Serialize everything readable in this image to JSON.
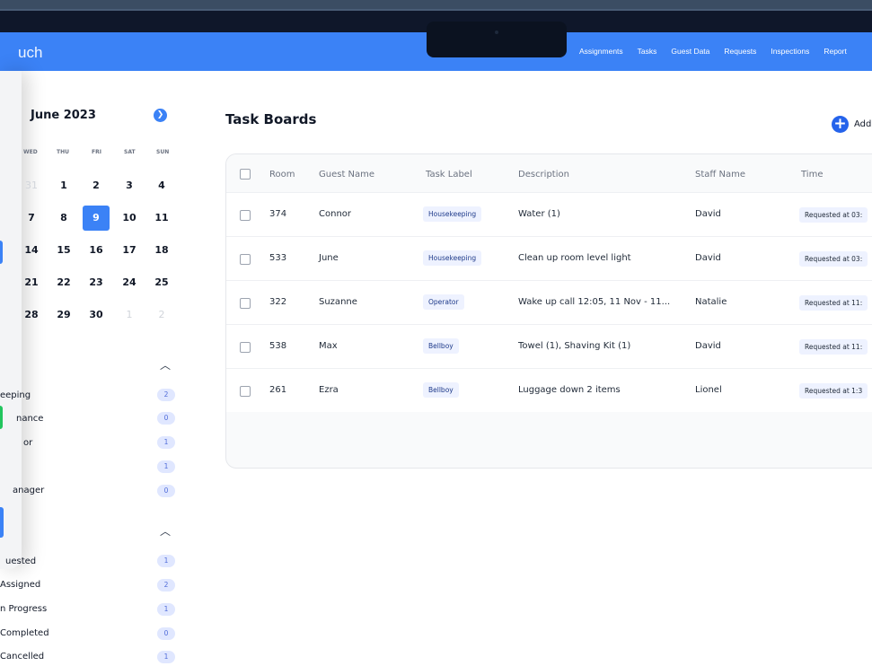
{
  "header": {
    "brand": "uch",
    "nav": [
      "Assignments",
      "Tasks",
      "Guest Data",
      "Requests",
      "Inspections",
      "Report"
    ]
  },
  "calendar": {
    "title": "June 2023",
    "weekdays": [
      "WED",
      "THU",
      "FRI",
      "SAT",
      "SUN"
    ],
    "weeks": [
      [
        "31",
        "1",
        "2",
        "3",
        "4"
      ],
      [
        "7",
        "8",
        "9",
        "10",
        "11"
      ],
      [
        "14",
        "15",
        "16",
        "17",
        "18"
      ],
      [
        "21",
        "22",
        "23",
        "24",
        "25"
      ],
      [
        "28",
        "29",
        "30",
        "1",
        "2"
      ]
    ],
    "selected": "9"
  },
  "categories": [
    {
      "label": "eeping",
      "count": "2"
    },
    {
      "label": "nance",
      "count": "0"
    },
    {
      "label": "or",
      "count": "1"
    },
    {
      "label": "",
      "count": "1"
    },
    {
      "label": "anager",
      "count": "0"
    }
  ],
  "statuses": [
    {
      "label": "uested",
      "count": "1"
    },
    {
      "label": "Assigned",
      "count": "2"
    },
    {
      "label": "n Progress",
      "count": "1"
    },
    {
      "label": "Completed",
      "count": "0"
    },
    {
      "label": "Cancelled",
      "count": "1"
    }
  ],
  "main": {
    "title": "Task Boards",
    "add_label": "Add",
    "columns": [
      "Room",
      "Guest Name",
      "Task Label",
      "Description",
      "Staff Name",
      "Time"
    ],
    "rows": [
      {
        "room": "374",
        "guest": "Connor",
        "label": "Housekeeping",
        "desc": "Water (1)",
        "staff": "David",
        "time": "Requested at 03:"
      },
      {
        "room": "533",
        "guest": "June",
        "label": "Housekeeping",
        "desc": "Clean up room level light",
        "staff": "David",
        "time": "Requested at 03:"
      },
      {
        "room": "322",
        "guest": "Suzanne",
        "label": "Operator",
        "desc": "Wake up call 12:05, 11 Nov - 11...",
        "staff": "Natalie",
        "time": "Requested at 11:"
      },
      {
        "room": "538",
        "guest": "Max",
        "label": "Bellboy",
        "desc": "Towel (1), Shaving Kit (1)",
        "staff": "David",
        "time": "Requested at 11:"
      },
      {
        "room": "261",
        "guest": "Ezra",
        "label": "Bellboy",
        "desc": "Luggage down 2 items",
        "staff": "Lionel",
        "time": "Requested at 1:3"
      }
    ]
  },
  "colors": {
    "accent": "#3b82f6",
    "topbar": "#0f172a"
  }
}
